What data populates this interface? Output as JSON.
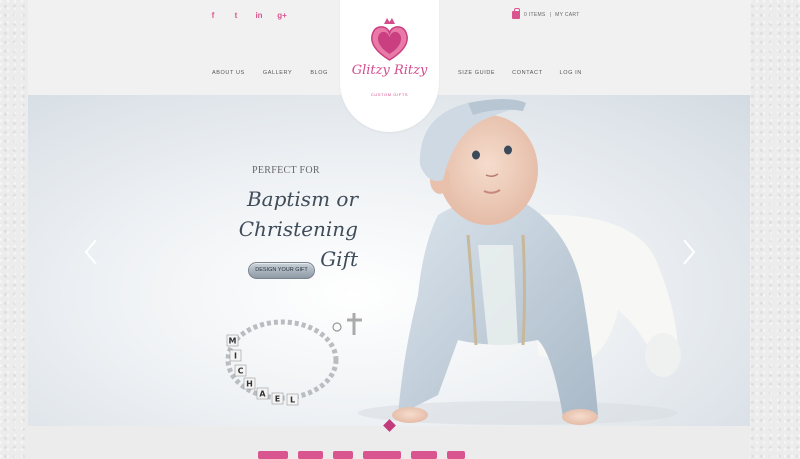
{
  "social": {
    "icons": [
      "facebook-icon",
      "twitter-icon",
      "linkedin-icon",
      "googleplus-icon"
    ],
    "glyphs": [
      "f",
      "t",
      "in",
      "g+"
    ]
  },
  "cart": {
    "items_label": "0 ITEMS",
    "separator": "|",
    "cart_label": "MY CART"
  },
  "nav": {
    "left": [
      "ABOUT US",
      "GALLERY",
      "BLOG"
    ],
    "right": [
      "SIZE GUIDE",
      "CONTACT",
      "LOG IN"
    ]
  },
  "logo": {
    "name": "Glitzy Ritzy",
    "tagline": "CUSTOM GIFTS"
  },
  "hero": {
    "eyebrow": "PERFECT FOR",
    "headline_line1": "Baptism or",
    "headline_line2": "Christening Gift",
    "cta": "DESIGN YOUR GIFT",
    "bracelet_letters": "MICHAEL"
  },
  "colors": {
    "accent": "#d9558f",
    "heading": "#3f4c5a",
    "diamond": "#c23b7c"
  }
}
